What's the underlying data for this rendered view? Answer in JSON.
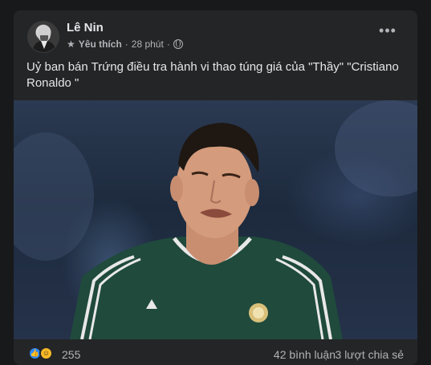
{
  "post": {
    "author": "Lê Nin",
    "favorite_label": "Yêu thích",
    "separator": "·",
    "time": "28 phút",
    "separator2": "·",
    "more_label": "•••",
    "text": "Uỷ ban bán Trứng điều tra hành vi thao túng giá của \"Thầy\" \"Cristiano Ronaldo \"",
    "photo_icon": "photo"
  },
  "footer": {
    "reactions": [
      "like-icon",
      "haha-icon"
    ],
    "reaction_count": "255",
    "comments": "42 bình luận",
    "shares": "3 lượt chia sẻ"
  },
  "colors": {
    "background": "#18191a",
    "card": "#242526",
    "text": "#e4e6eb",
    "secondary": "#b0b3b8",
    "like": "#2d88ff",
    "haha": "#f7b928",
    "jersey": "#1f4a3c"
  }
}
